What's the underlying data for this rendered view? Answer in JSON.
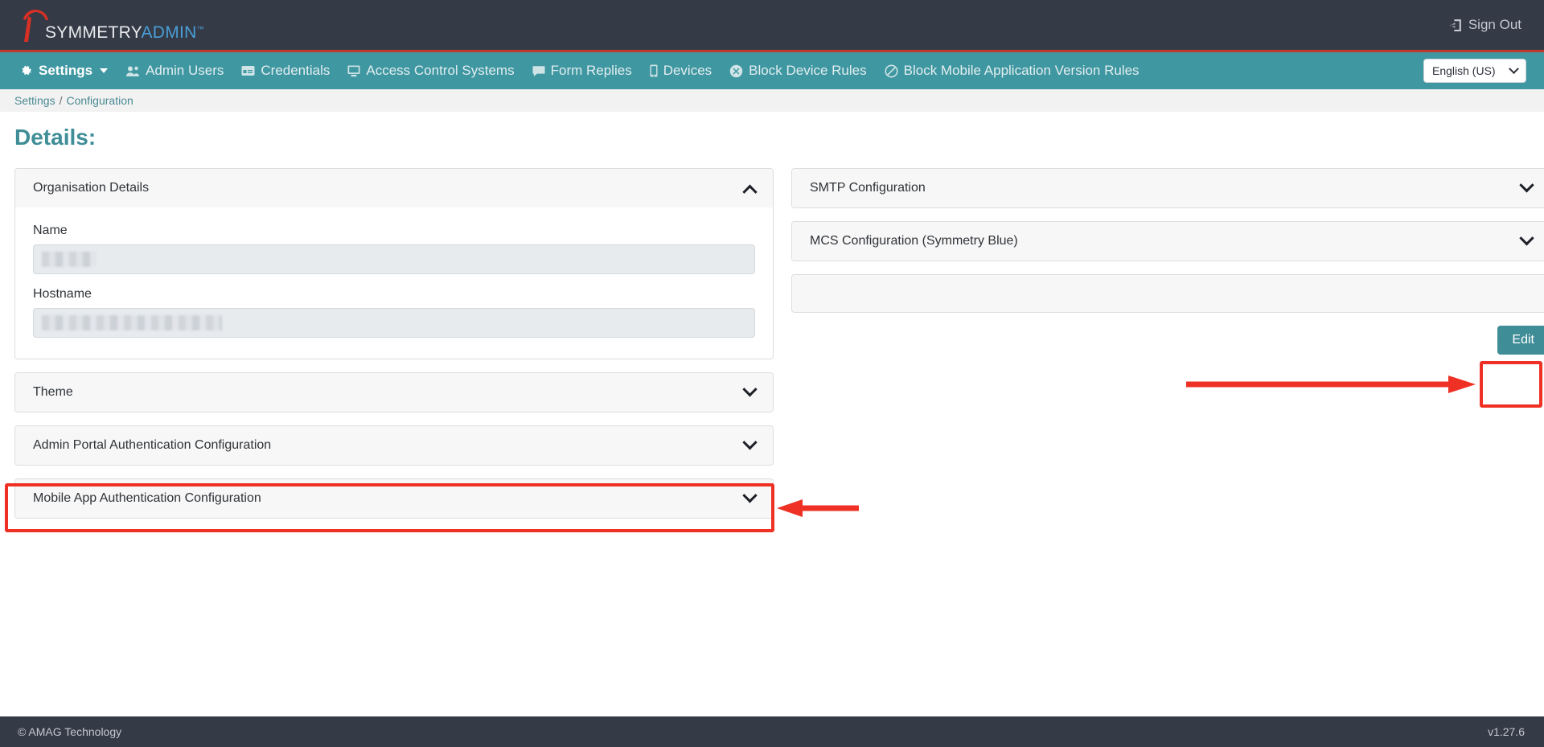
{
  "header": {
    "brand_symmetry": "SYMMETRY",
    "brand_admin": "ADMIN",
    "brand_tm": "™",
    "signout_label": "Sign Out",
    "signout_icon": "sign-out-icon"
  },
  "nav": {
    "items": [
      {
        "label": "Settings",
        "icon": "gear-icon",
        "active": true,
        "has_caret": true
      },
      {
        "label": "Admin Users",
        "icon": "users-icon",
        "active": false,
        "has_caret": false
      },
      {
        "label": "Credentials",
        "icon": "id-card-icon",
        "active": false,
        "has_caret": false
      },
      {
        "label": "Access Control Systems",
        "icon": "desktop-icon",
        "active": false,
        "has_caret": false
      },
      {
        "label": "Form Replies",
        "icon": "comment-icon",
        "active": false,
        "has_caret": false
      },
      {
        "label": "Devices",
        "icon": "mobile-icon",
        "active": false,
        "has_caret": false
      },
      {
        "label": "Block Device Rules",
        "icon": "times-circle-icon",
        "active": false,
        "has_caret": false
      },
      {
        "label": "Block Mobile Application Version Rules",
        "icon": "ban-icon",
        "active": false,
        "has_caret": false
      }
    ],
    "language": {
      "selected": "English (US)",
      "icon": "chevron-down-icon"
    }
  },
  "breadcrumb": {
    "root": "Settings",
    "separator": "/",
    "current": "Configuration"
  },
  "page": {
    "title": "Details:"
  },
  "left_column": {
    "panels": [
      {
        "title": "Organisation Details",
        "expanded": true,
        "toggle_icon": "chevron-up-icon",
        "fields": [
          {
            "label": "Name",
            "value": "",
            "redacted": true,
            "redaction_width": "short"
          },
          {
            "label": "Hostname",
            "value": "",
            "redacted": true,
            "redaction_width": "long"
          }
        ]
      },
      {
        "title": "Theme",
        "expanded": false,
        "toggle_icon": "chevron-down-icon"
      },
      {
        "title": "Admin Portal Authentication Configuration",
        "expanded": false,
        "toggle_icon": "chevron-down-icon",
        "highlighted": true
      },
      {
        "title": "Mobile App Authentication Configuration",
        "expanded": false,
        "toggle_icon": "chevron-down-icon"
      }
    ]
  },
  "right_column": {
    "panels": [
      {
        "title": "SMTP Configuration",
        "expanded": false,
        "toggle_icon": "chevron-down-icon"
      },
      {
        "title": "MCS Configuration (Symmetry Blue)",
        "expanded": false,
        "toggle_icon": "chevron-down-icon"
      },
      {
        "title": "",
        "expanded": false,
        "blank": true
      }
    ],
    "edit_button": {
      "label": "Edit",
      "highlighted": true
    }
  },
  "footer": {
    "copyright": "© AMAG Technology",
    "version": "v1.27.6"
  },
  "colors": {
    "topbar_bg": "#343a46",
    "accent_red": "#c0392b",
    "nav_teal": "#3f97a1",
    "brand_blue": "#4a9fd8",
    "title_teal": "#3f8d97",
    "button_teal": "#3f8d97",
    "annotation_red": "#ee3124",
    "panel_head_bg": "#f7f7f7",
    "input_bg": "#e8ebee"
  }
}
